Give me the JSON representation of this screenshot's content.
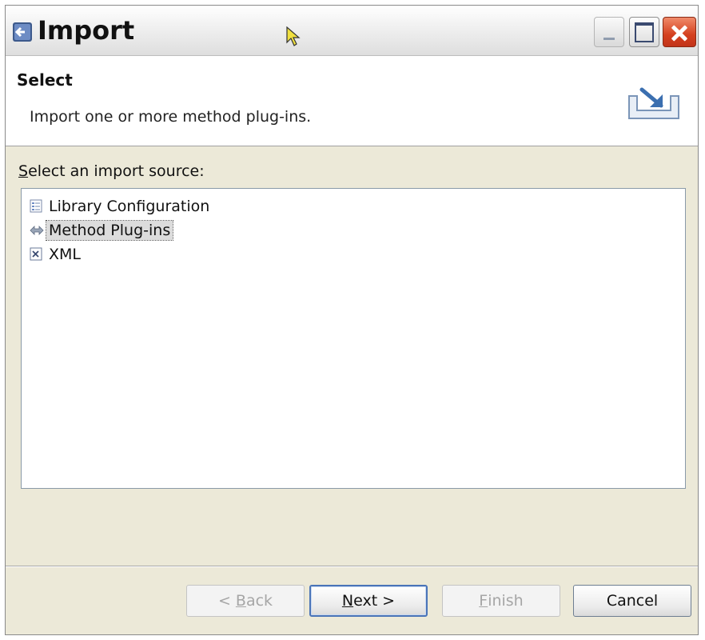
{
  "window": {
    "title": "Import",
    "icon": "wizard-app-icon",
    "controls": [
      "minimize-icon",
      "maximize-icon",
      "close-icon"
    ]
  },
  "header": {
    "title": "Select",
    "description": "Import one or more method plug-ins.",
    "banner_icon": "import-wizard-icon"
  },
  "source": {
    "label_mnemonic": "S",
    "label_rest": "elect an import source:",
    "items": [
      {
        "label": "Library Configuration",
        "icon": "library-configuration-icon",
        "selected": false
      },
      {
        "label": "Method Plug-ins",
        "icon": "method-plugin-icon",
        "selected": true
      },
      {
        "label": "XML",
        "icon": "xml-file-icon",
        "selected": false
      }
    ]
  },
  "buttons": {
    "back": {
      "prefix": "< ",
      "mnemonic": "B",
      "rest": "ack",
      "enabled": false
    },
    "next": {
      "mnemonic": "N",
      "rest": "ext >",
      "enabled": true
    },
    "finish": {
      "mnemonic": "F",
      "rest": "inish",
      "enabled": false
    },
    "cancel": {
      "label": "Cancel",
      "enabled": true
    }
  },
  "colors": {
    "dialog_bg": "#ece9d8",
    "close_button": "#d4401e",
    "default_button_border": "#4a74b8",
    "selection_bg": "#dcdcdc"
  }
}
